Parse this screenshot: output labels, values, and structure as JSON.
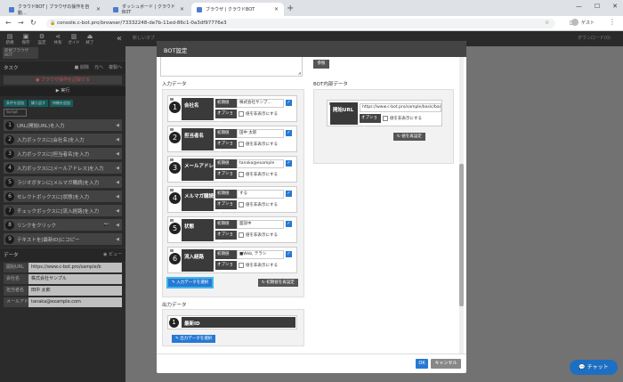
{
  "browser": {
    "tabs": [
      {
        "title": "クラウドBOT | ブラウザの操作を自動…"
      },
      {
        "title": "ダッシュボード | クラウドBOT"
      },
      {
        "title": "ブラウザ | クラウドBOT"
      }
    ],
    "url": "console.c-bot.pro/browser/73332248-de7b-11ed-86c1-0a3df97776e3",
    "guest": "ゲスト"
  },
  "sidebar": {
    "toolbar": [
      {
        "label": "新規",
        "icon": "file-icon"
      },
      {
        "label": "保存",
        "icon": "save-icon"
      },
      {
        "label": "設定",
        "icon": "gear-icon"
      },
      {
        "label": "共有",
        "icon": "share-icon"
      },
      {
        "label": "ガイド",
        "icon": "book-icon"
      },
      {
        "label": "終了",
        "icon": "exit-icon"
      }
    ],
    "title_badge": "新規ブラウザBOT",
    "task_label": "タスク",
    "task_actions": [
      "■ 削除",
      "元へ",
      "複製へ"
    ],
    "record_button": "ブラウザ操作を記録する",
    "run_button": "実行",
    "tags": [
      "条件を追加",
      "繰り返す",
      "待機を追加"
    ],
    "script_button": "Script",
    "steps": [
      "URL(開始URL)を入力",
      "入力ボックスに[会社名]を入力",
      "入力ボックスに[担当者名]を入力",
      "入力ボックスに[メールアドレス]を入力",
      "ラジオボタンに[メルマガ購読]を入力",
      "セレクトボックスに[状態]を入力",
      "チェックボックスに[流入経路]を入力",
      "リンクをクリック",
      "テキストを[最新ID]にコピー"
    ],
    "data_label": "データ",
    "data_view": "ビュー",
    "data_rows": [
      {
        "key": "開始URL",
        "value": "https://www.c-bot.pro/sample/b"
      },
      {
        "key": "会社名",
        "value": "株式会社サンプル"
      },
      {
        "key": "担当者名",
        "value": "田中 太郎"
      },
      {
        "key": "メールアド",
        "value": "tanaka@example.com"
      }
    ]
  },
  "background": {
    "new_tab": "新しいタブ",
    "download": "ダウンロード(0)"
  },
  "modal": {
    "title": "BOT設定",
    "ref_button": "参照",
    "input_label": "入力データ",
    "internal_label": "BOT内部データ",
    "output_label": "出力データ",
    "initial_label": "初期値",
    "option_label": "オプション",
    "hide_text": "値を非表示にする",
    "inputs": [
      {
        "num": "1",
        "name": "会社名",
        "value": "株式会社サンプ…",
        "checked": true
      },
      {
        "num": "2",
        "name": "担当者名",
        "value": "田中 太郎",
        "checked": true
      },
      {
        "num": "3",
        "name": "メールアドレ",
        "value": "tanaka@example",
        "checked": true
      },
      {
        "num": "4",
        "name": "メルマガ購読",
        "value": "する",
        "checked": true
      },
      {
        "num": "5",
        "name": "状態",
        "value": "面談中",
        "checked": true
      },
      {
        "num": "6",
        "name": "流入経路",
        "value": "■Web, テラシ",
        "checked": true
      }
    ],
    "select_input_button": "入力データを選択",
    "reset_button": "初期値を再設定",
    "internal": {
      "name": "開始URL",
      "value": "https://www.c-bot.pro/sample/basic/bas",
      "reset": "値を再設定"
    },
    "output": {
      "num": "1",
      "name": "最新ID"
    },
    "select_output_button": "出力データを選択",
    "ok": "OK",
    "cancel": "キャンセル"
  },
  "chat": "チャット"
}
